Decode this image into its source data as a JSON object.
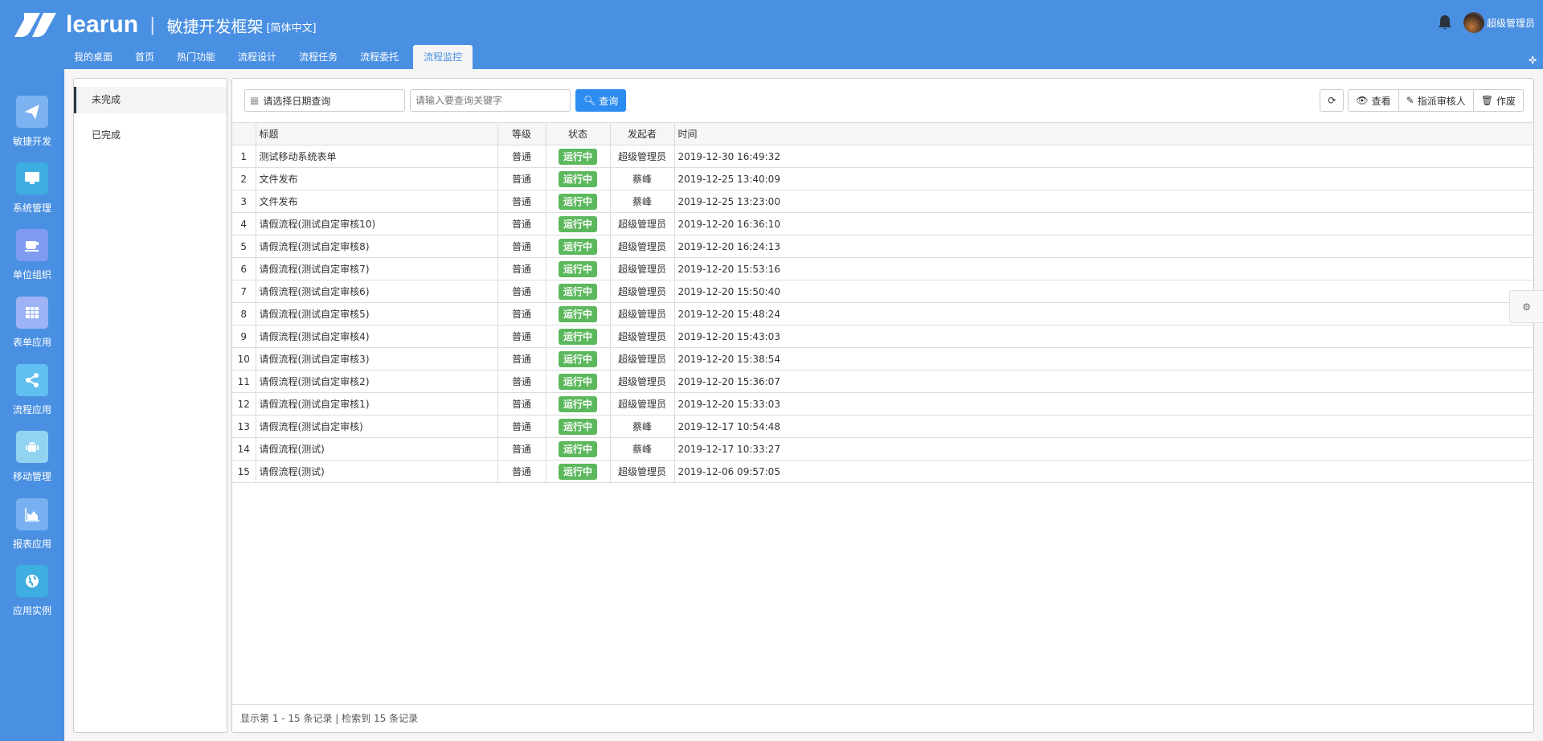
{
  "header": {
    "brand": "learun",
    "separator": "|",
    "subtitle": "敏捷开发框架",
    "language": "[简体中文]",
    "user": "超级管理员"
  },
  "tabs": [
    "我的桌面",
    "首页",
    "热门功能",
    "流程设计",
    "流程任务",
    "流程委托",
    "流程监控"
  ],
  "leftnav": [
    {
      "label": "敏捷开发",
      "icon": "paper-plane-icon",
      "color": "#7cb2f2"
    },
    {
      "label": "系统管理",
      "icon": "desktop-icon",
      "color": "#3eade0"
    },
    {
      "label": "单位组织",
      "icon": "coffee-icon",
      "color": "#7f9cf2"
    },
    {
      "label": "表单应用",
      "icon": "table-icon",
      "color": "#9db3f5"
    },
    {
      "label": "流程应用",
      "icon": "share-icon",
      "color": "#62c0f0"
    },
    {
      "label": "移动管理",
      "icon": "android-icon",
      "color": "#93d3f2"
    },
    {
      "label": "报表应用",
      "icon": "area-chart-icon",
      "color": "#79b0f2"
    },
    {
      "label": "应用实例",
      "icon": "globe-icon",
      "color": "#3eade0"
    }
  ],
  "sidepanel": {
    "items": [
      "未完成",
      "已完成"
    ]
  },
  "toolbar": {
    "date_placeholder": "请选择日期查询",
    "keyword_placeholder": "请输入要查询关键字",
    "search": "查询",
    "view": "查看",
    "assign": "指派审核人",
    "void": "作废"
  },
  "table": {
    "columns": [
      "",
      "标题",
      "等级",
      "状态",
      "发起者",
      "时间"
    ],
    "rows": [
      [
        "1",
        "测试移动系统表单",
        "普通",
        "运行中",
        "超级管理员",
        "2019-12-30 16:49:32"
      ],
      [
        "2",
        "文件发布",
        "普通",
        "运行中",
        "蔡峰",
        "2019-12-25 13:40:09"
      ],
      [
        "3",
        "文件发布",
        "普通",
        "运行中",
        "蔡峰",
        "2019-12-25 13:23:00"
      ],
      [
        "4",
        "请假流程(测试自定审核10)",
        "普通",
        "运行中",
        "超级管理员",
        "2019-12-20 16:36:10"
      ],
      [
        "5",
        "请假流程(测试自定审核8)",
        "普通",
        "运行中",
        "超级管理员",
        "2019-12-20 16:24:13"
      ],
      [
        "6",
        "请假流程(测试自定审核7)",
        "普通",
        "运行中",
        "超级管理员",
        "2019-12-20 15:53:16"
      ],
      [
        "7",
        "请假流程(测试自定审核6)",
        "普通",
        "运行中",
        "超级管理员",
        "2019-12-20 15:50:40"
      ],
      [
        "8",
        "请假流程(测试自定审核5)",
        "普通",
        "运行中",
        "超级管理员",
        "2019-12-20 15:48:24"
      ],
      [
        "9",
        "请假流程(测试自定审核4)",
        "普通",
        "运行中",
        "超级管理员",
        "2019-12-20 15:43:03"
      ],
      [
        "10",
        "请假流程(测试自定审核3)",
        "普通",
        "运行中",
        "超级管理员",
        "2019-12-20 15:38:54"
      ],
      [
        "11",
        "请假流程(测试自定审核2)",
        "普通",
        "运行中",
        "超级管理员",
        "2019-12-20 15:36:07"
      ],
      [
        "12",
        "请假流程(测试自定审核1)",
        "普通",
        "运行中",
        "超级管理员",
        "2019-12-20 15:33:03"
      ],
      [
        "13",
        "请假流程(测试自定审核)",
        "普通",
        "运行中",
        "蔡峰",
        "2019-12-17 10:54:48"
      ],
      [
        "14",
        "请假流程(测试)",
        "普通",
        "运行中",
        "蔡峰",
        "2019-12-17 10:33:27"
      ],
      [
        "15",
        "请假流程(测试)",
        "普通",
        "运行中",
        "超级管理员",
        "2019-12-06 09:57:05"
      ]
    ]
  },
  "footer": "显示第 1 - 15 条记录 | 检索到 15 条记录"
}
